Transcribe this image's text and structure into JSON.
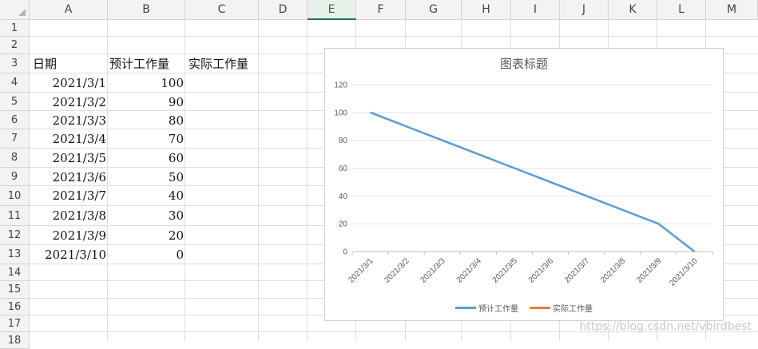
{
  "columns": [
    "A",
    "B",
    "C",
    "D",
    "E",
    "F",
    "G",
    "H",
    "I",
    "J",
    "K",
    "L",
    "M"
  ],
  "selected_column": "E",
  "rows": [
    "1",
    "2",
    "3",
    "4",
    "5",
    "6",
    "7",
    "8",
    "9",
    "10",
    "11",
    "12",
    "13",
    "14",
    "15",
    "16",
    "17",
    "18"
  ],
  "headers": {
    "a3": "日期",
    "b3": "预计工作量",
    "c3": "实际工作量"
  },
  "table": [
    {
      "date": "2021/3/1",
      "planned": "100"
    },
    {
      "date": "2021/3/2",
      "planned": "90"
    },
    {
      "date": "2021/3/3",
      "planned": "80"
    },
    {
      "date": "2021/3/4",
      "planned": "70"
    },
    {
      "date": "2021/3/5",
      "planned": "60"
    },
    {
      "date": "2021/3/6",
      "planned": "50"
    },
    {
      "date": "2021/3/7",
      "planned": "40"
    },
    {
      "date": "2021/3/8",
      "planned": "30"
    },
    {
      "date": "2021/3/9",
      "planned": "20"
    },
    {
      "date": "2021/3/10",
      "planned": "0"
    }
  ],
  "chart_data": {
    "type": "line",
    "title": "图表标题",
    "categories": [
      "2021/3/1",
      "2021/3/2",
      "2021/3/3",
      "2021/3/4",
      "2021/3/5",
      "2021/3/6",
      "2021/3/7",
      "2021/3/8",
      "2021/3/9",
      "2021/3/10"
    ],
    "series": [
      {
        "name": "预计工作量",
        "color": "#5b9bd5",
        "values": [
          100,
          90,
          80,
          70,
          60,
          50,
          40,
          30,
          20,
          0
        ]
      },
      {
        "name": "实际工作量",
        "color": "#ed7d31",
        "values": []
      }
    ],
    "ylim": [
      0,
      120
    ],
    "yticks": [
      0,
      20,
      40,
      60,
      80,
      100,
      120
    ],
    "grid": true,
    "legend": "bottom"
  },
  "watermark": "https://blog.csdn.net/vbirdbest"
}
